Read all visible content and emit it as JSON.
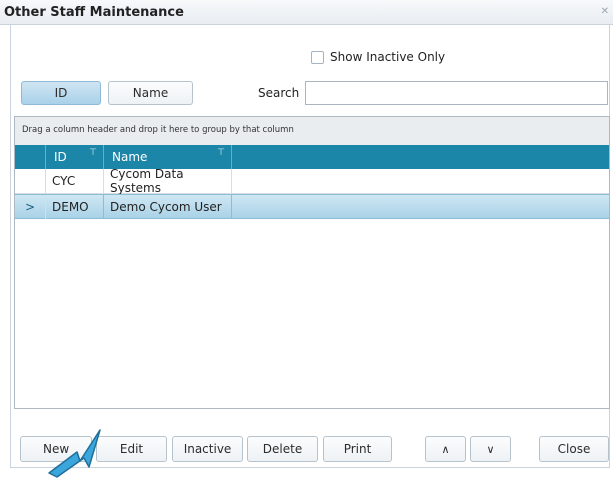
{
  "window": {
    "title": "Other Staff Maintenance",
    "close_glyph": "✕"
  },
  "filter": {
    "show_inactive_label": "Show Inactive Only"
  },
  "search_bar": {
    "id_tab": "ID",
    "name_tab": "Name",
    "search_label": "Search",
    "search_value": ""
  },
  "grid": {
    "group_hint": "Drag a column header and drop it here to group by that column",
    "columns": [
      {
        "label": "ID",
        "filter_icon": "filter-icon"
      },
      {
        "label": "Name",
        "filter_icon": "filter-icon"
      }
    ],
    "rows": [
      {
        "id": "CYC",
        "name": "Cycom Data Systems",
        "selected": false
      },
      {
        "id": "DEMO",
        "name": "Demo Cycom User",
        "selected": true,
        "indicator": ">"
      }
    ]
  },
  "toolbar": {
    "new_label": "New",
    "edit_label": "Edit",
    "inactive_label": "Inactive",
    "delete_label": "Delete",
    "print_label": "Print",
    "up_label": "∧",
    "down_label": "∨",
    "close_label": "Close"
  },
  "colors": {
    "header_bg": "#1b86a7",
    "selected_row": "#a9d2e7",
    "active_tab": "#a9d1ea",
    "pointer_arrow": "#3aa6dc"
  }
}
